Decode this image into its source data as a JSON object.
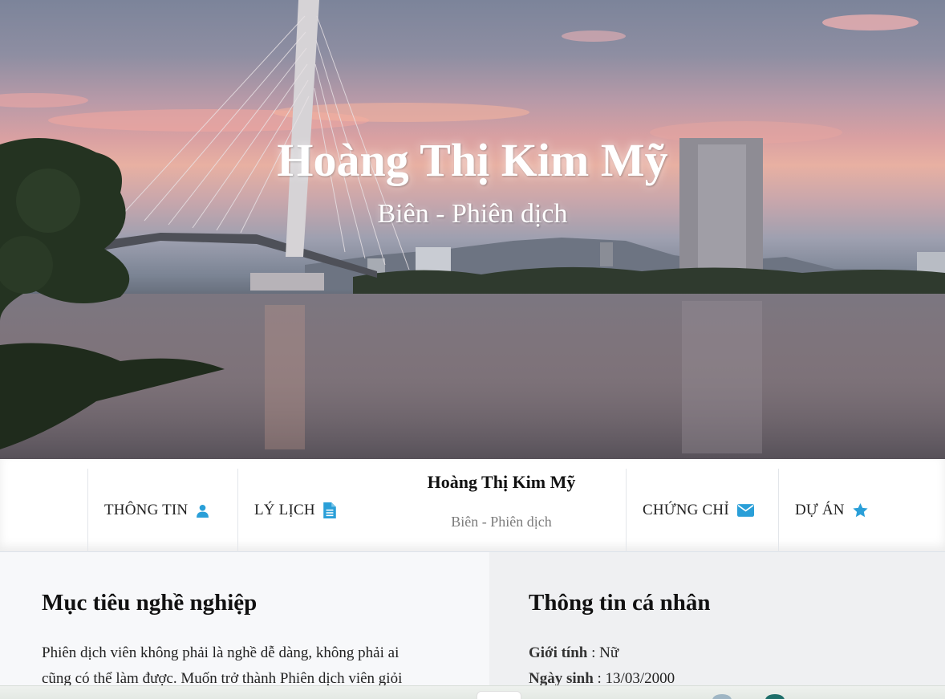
{
  "hero": {
    "title": "Hoàng Thị Kim Mỹ",
    "subtitle": "Biên - Phiên dịch"
  },
  "nav": {
    "items": [
      {
        "label": "THÔNG TIN",
        "icon": "user-icon"
      },
      {
        "label": "LÝ LỊCH",
        "icon": "document-icon"
      },
      {
        "label": "CHỨNG CHỈ",
        "icon": "envelope-icon"
      },
      {
        "label": "DỰ ÁN",
        "icon": "star-icon"
      }
    ],
    "brand_name": "Hoàng Thị Kim Mỹ",
    "brand_role": "Biên - Phiên dịch",
    "icon_color": "#2a9fd8"
  },
  "career": {
    "heading": "Mục tiêu nghề nghiệp",
    "line1": "Phiên dịch viên không phải là nghề dễ dàng, không phải ai",
    "line2": "cũng có thể làm được. Muốn trở thành Phiên dịch viên giỏi"
  },
  "personal": {
    "heading": "Thông tin cá nhân",
    "gender_label": "Giới tính",
    "gender_value": " : Nữ",
    "dob_label": "Ngày sinh",
    "dob_value": " : 13/03/2000"
  }
}
